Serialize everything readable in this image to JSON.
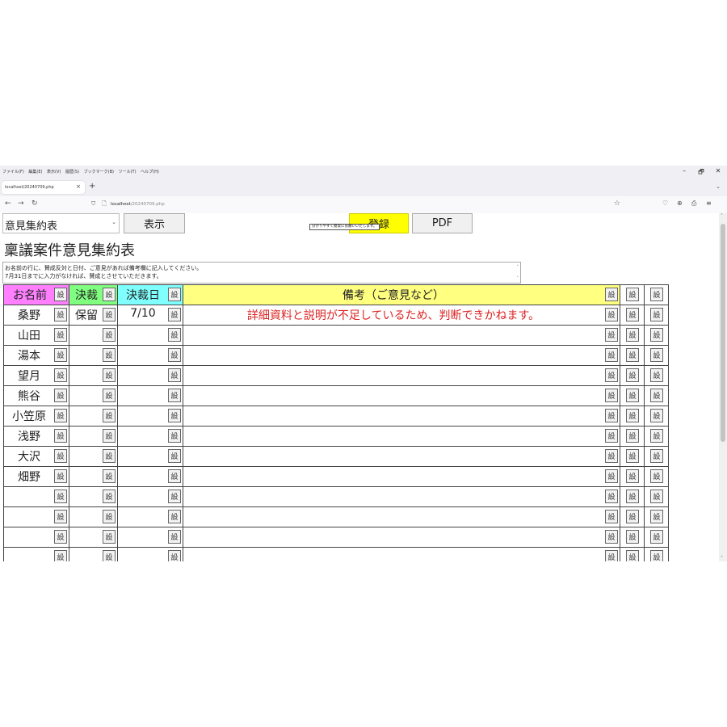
{
  "browser": {
    "menu": [
      "ファイル(F)",
      "編集(E)",
      "表示(V)",
      "履歴(S)",
      "ブックマーク(B)",
      "ツール(T)",
      "ヘルプ(H)"
    ],
    "window_controls": [
      "–",
      "🗗",
      "✕"
    ],
    "tab": {
      "title": "localhost/20240709.php",
      "close": "×"
    },
    "new_tab": "+",
    "tab_list": "⌄",
    "nav": {
      "back": "←",
      "forward": "→",
      "reload": "↻"
    },
    "url_host": "localhost",
    "url_path": "/20240709.php",
    "icons": {
      "shield": "⛉",
      "page": "🗋",
      "star": "☆",
      "pocket": "♡",
      "account": "⊕",
      "extensions": "⎙",
      "menu": "≡"
    }
  },
  "toolbar": {
    "select_value": "意見集約表",
    "select_arrow": "⌄",
    "show_label": "表示",
    "register_label": "登録",
    "pdf_label": "PDF"
  },
  "page_title": "稟議案件意見集約表",
  "instructions": "お名前の行に、賛成反対と日付、ご意見があれば備考欄に記入してください。\n7月31日までに入力がなければ、賛成とさせていただきます。",
  "scroll_arrows": {
    "up": "˄",
    "down": "˅"
  },
  "table": {
    "setting_label": "設",
    "headers": {
      "name": "お名前",
      "decision": "決裁",
      "date": "決裁日",
      "remarks": "備考（ご意見など）"
    },
    "header_colors": {
      "name": "#ff7fff",
      "decision": "#80ff80",
      "date": "#80ffff",
      "remarks": "#ffff80"
    },
    "remark_color": "#dd2222",
    "tooltip": "分かりやすく簡潔にお願いいたします。",
    "rows": [
      {
        "name": "桑野",
        "decision": "保留",
        "date": "7/10",
        "remarks": "詳細資料と説明が不足しているため、判断できかねます。"
      },
      {
        "name": "山田",
        "decision": "",
        "date": "",
        "remarks": ""
      },
      {
        "name": "湯本",
        "decision": "",
        "date": "",
        "remarks": ""
      },
      {
        "name": "望月",
        "decision": "",
        "date": "",
        "remarks": ""
      },
      {
        "name": "熊谷",
        "decision": "",
        "date": "",
        "remarks": ""
      },
      {
        "name": "小笠原",
        "decision": "",
        "date": "",
        "remarks": ""
      },
      {
        "name": "浅野",
        "decision": "",
        "date": "",
        "remarks": ""
      },
      {
        "name": "大沢",
        "decision": "",
        "date": "",
        "remarks": ""
      },
      {
        "name": "畑野",
        "decision": "",
        "date": "",
        "remarks": ""
      },
      {
        "name": "",
        "decision": "",
        "date": "",
        "remarks": ""
      },
      {
        "name": "",
        "decision": "",
        "date": "",
        "remarks": ""
      },
      {
        "name": "",
        "decision": "",
        "date": "",
        "remarks": ""
      },
      {
        "name": "",
        "decision": "",
        "date": "",
        "remarks": ""
      }
    ]
  }
}
